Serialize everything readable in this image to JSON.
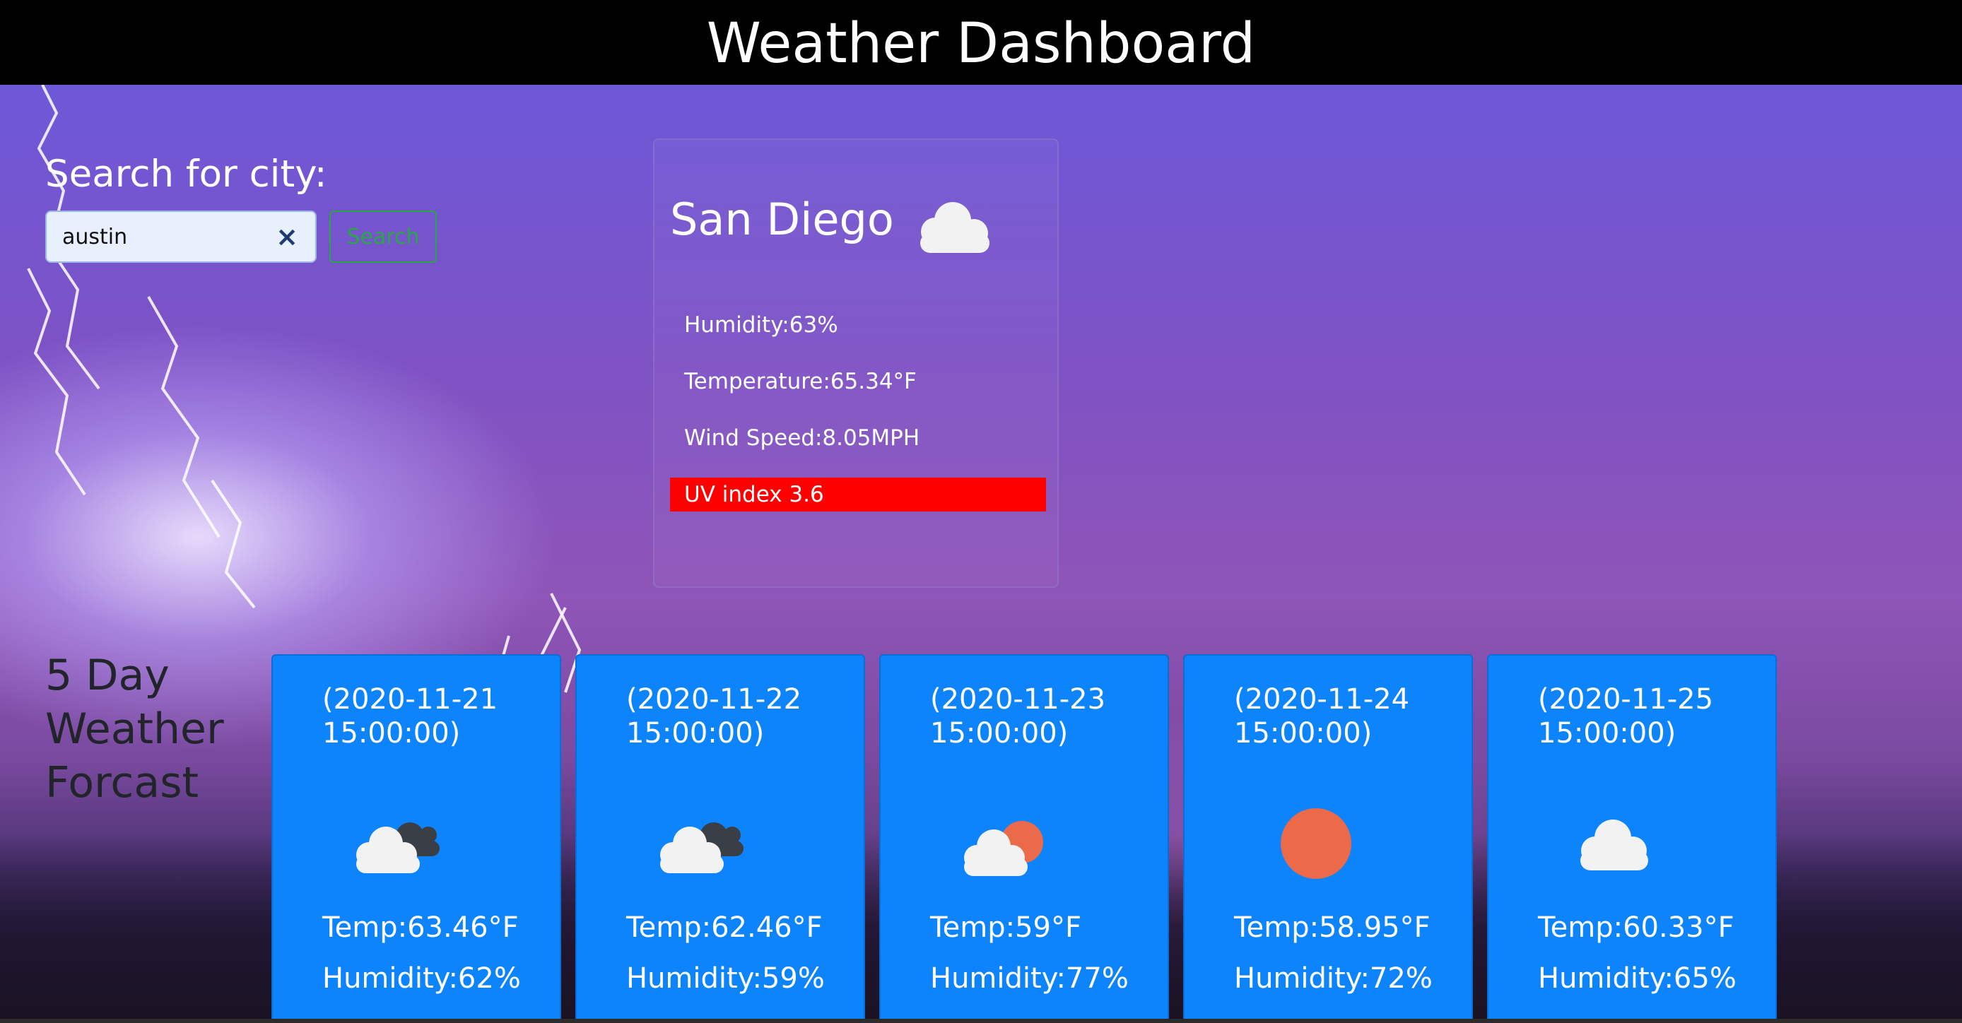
{
  "header": {
    "title": "Weather Dashboard"
  },
  "search": {
    "label": "Search for city:",
    "value": "austin",
    "clear_icon": "×",
    "button_label": "Search"
  },
  "current": {
    "city": "San Diego",
    "icon": "cloud-icon",
    "humidity": "Humidity:63%",
    "temperature": "Temperature:65.34°F",
    "wind": "Wind Speed:8.05MPH",
    "uv": "UV index 3.6",
    "uv_color": "#ff0000"
  },
  "forecast": {
    "title": "5 Day Weather Forcast",
    "days": [
      {
        "date": "(2020-11-21 15:00:00)",
        "icon": "broken-clouds-icon",
        "temp": "Temp:63.46°F",
        "humidity": "Humidity:62%"
      },
      {
        "date": "(2020-11-22 15:00:00)",
        "icon": "broken-clouds-icon",
        "temp": "Temp:62.46°F",
        "humidity": "Humidity:59%"
      },
      {
        "date": "(2020-11-23 15:00:00)",
        "icon": "partly-cloudy-icon",
        "temp": "Temp:59°F",
        "humidity": "Humidity:77%"
      },
      {
        "date": "(2020-11-24 15:00:00)",
        "icon": "sun-icon",
        "temp": "Temp:58.95°F",
        "humidity": "Humidity:72%"
      },
      {
        "date": "(2020-11-25 15:00:00)",
        "icon": "cloud-icon",
        "temp": "Temp:60.33°F",
        "humidity": "Humidity:65%"
      }
    ],
    "card_color": "#0d84fb"
  }
}
